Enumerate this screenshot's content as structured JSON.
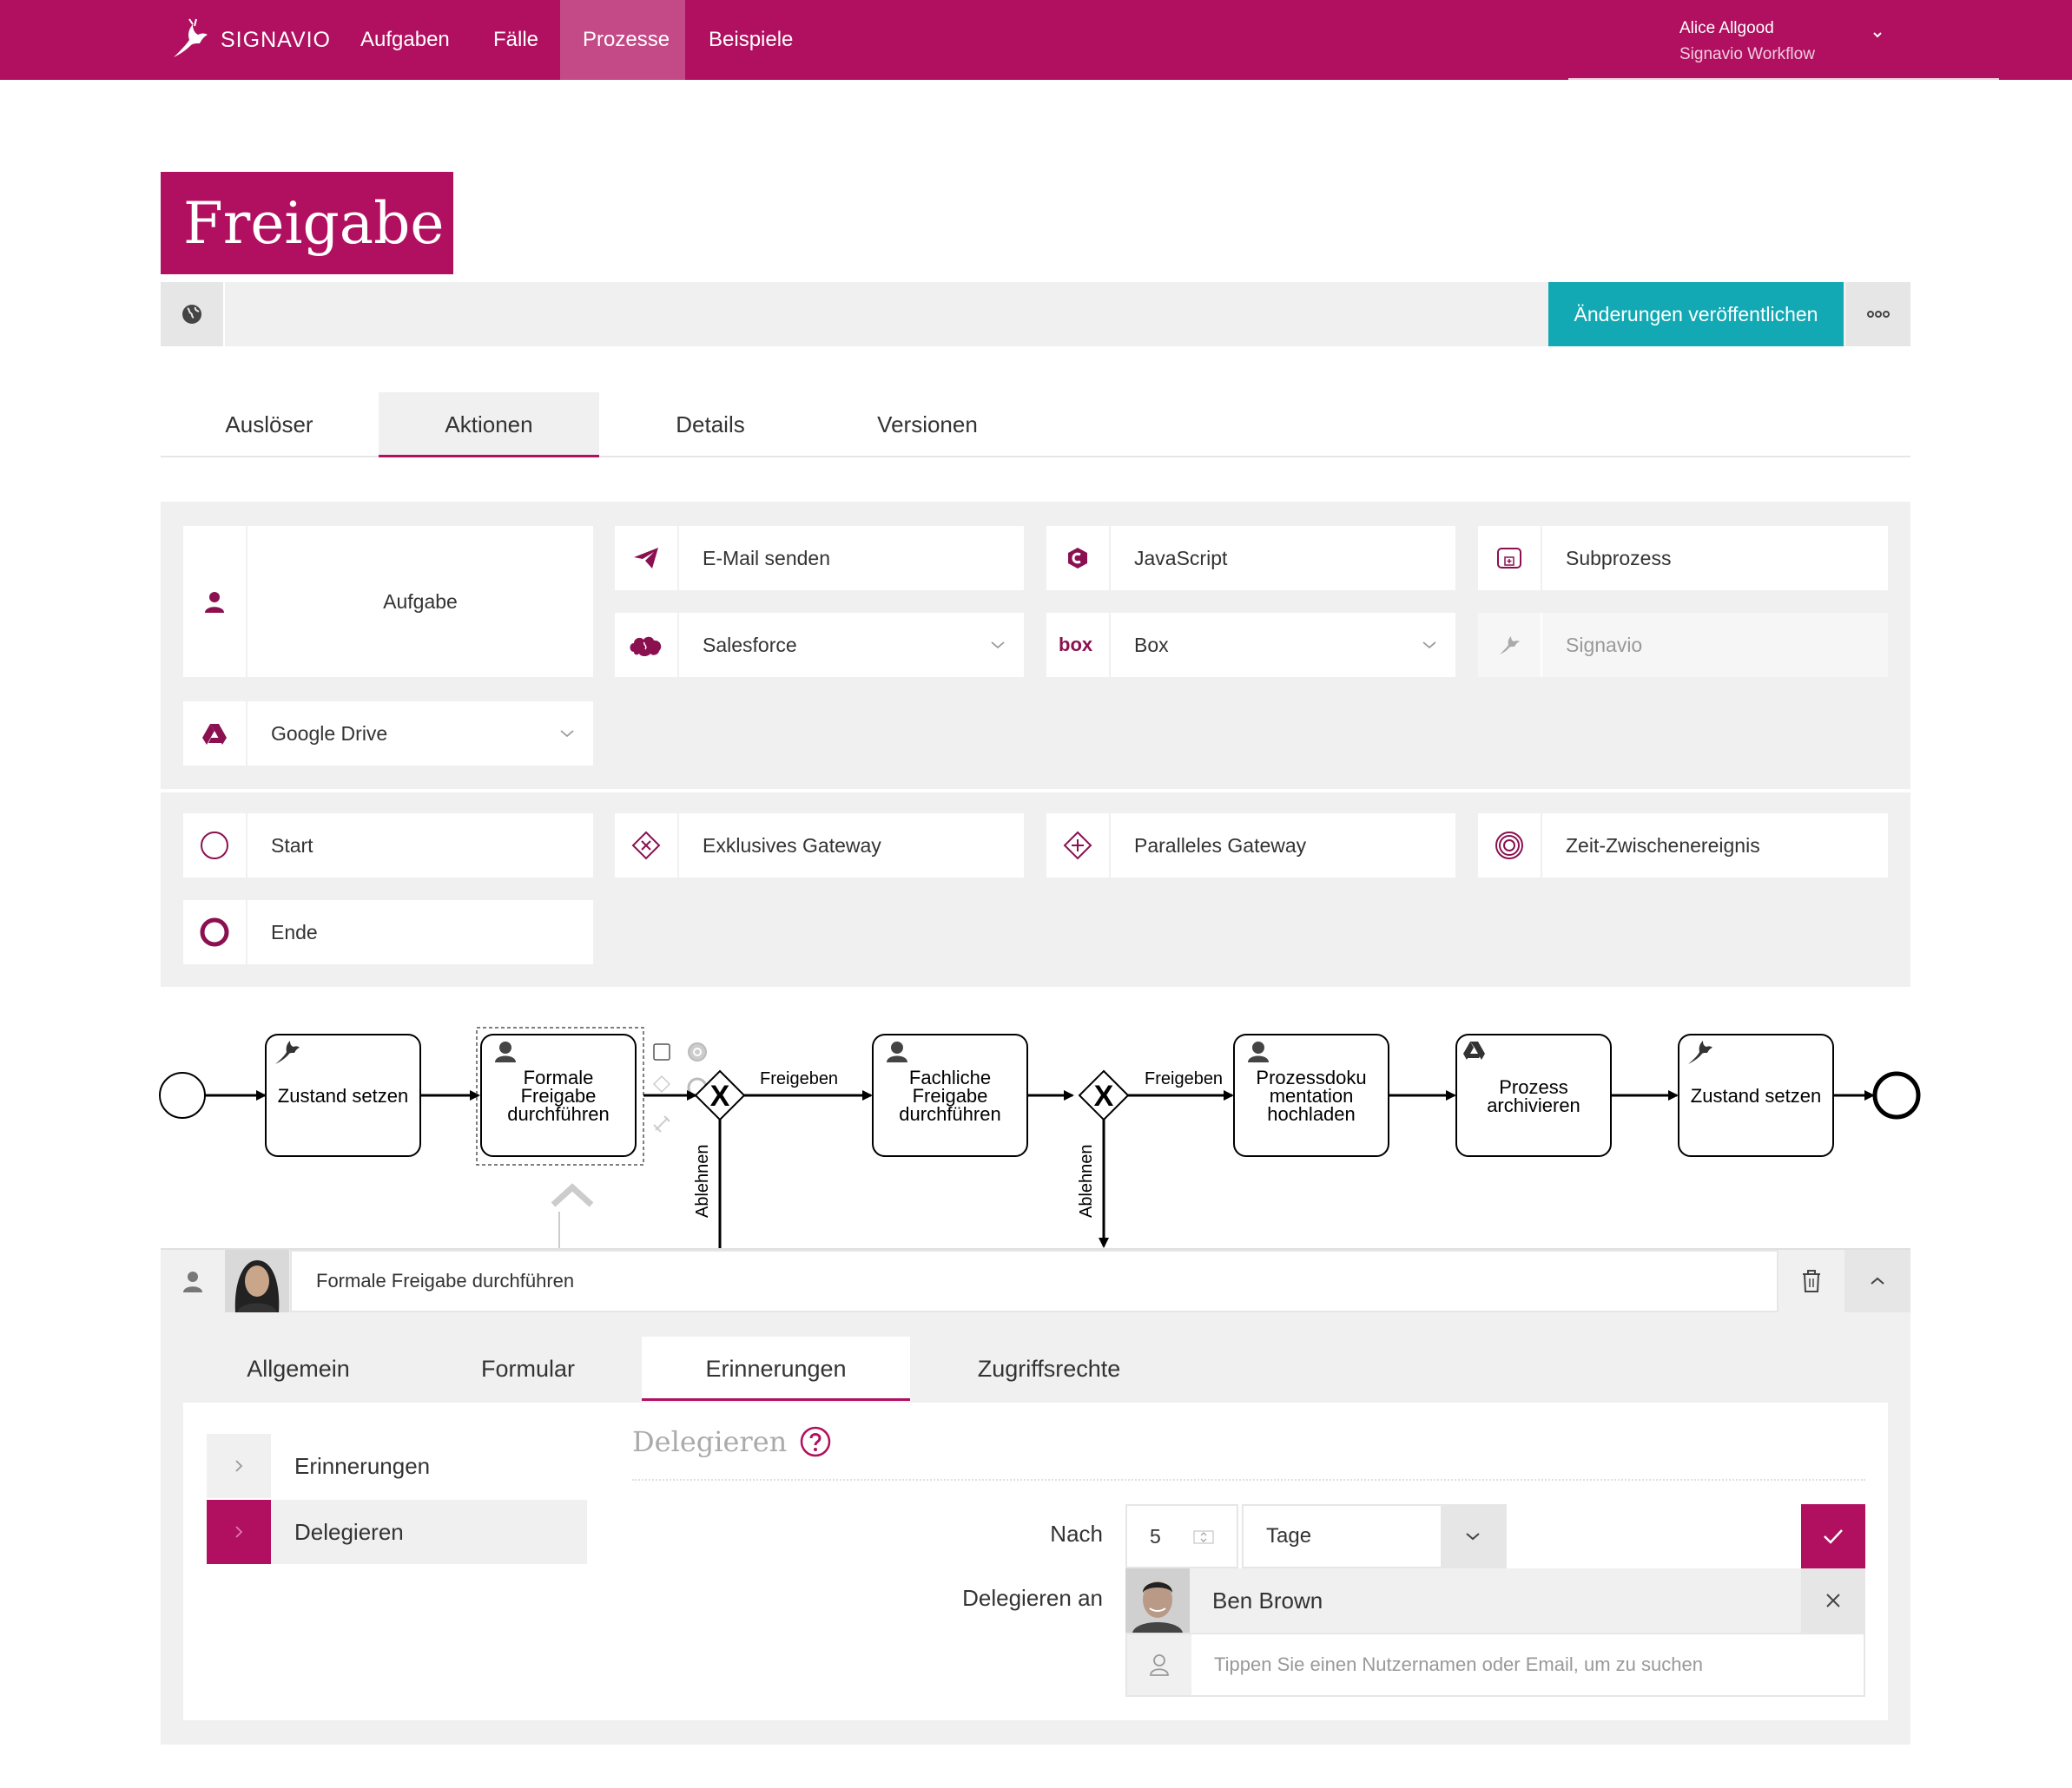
{
  "nav": {
    "brand": "SIGNAVIO",
    "items": [
      {
        "label": "Aufgaben",
        "active": false
      },
      {
        "label": "Fälle",
        "active": false
      },
      {
        "label": "Prozesse",
        "active": true
      },
      {
        "label": "Beispiele",
        "active": false
      }
    ],
    "user_name": "Alice Allgood",
    "user_org": "Signavio Workflow"
  },
  "page": {
    "title": "Freigabe",
    "publish_label": "Änderungen veröffentlichen"
  },
  "tabs": [
    {
      "label": "Auslöser",
      "active": false
    },
    {
      "label": "Aktionen",
      "active": true
    },
    {
      "label": "Details",
      "active": false
    },
    {
      "label": "Versionen",
      "active": false
    }
  ],
  "palette": {
    "actions": [
      {
        "label": "Aufgabe",
        "icon": "user-icon"
      },
      {
        "label": "E-Mail senden",
        "icon": "paper-plane-icon"
      },
      {
        "label": "JavaScript",
        "icon": "javascript-icon"
      },
      {
        "label": "Subprozess",
        "icon": "subprocess-icon"
      },
      {
        "label": "Salesforce",
        "icon": "salesforce-icon"
      },
      {
        "label": "Box",
        "icon": "box-icon"
      },
      {
        "label": "Signavio",
        "icon": "signavio-icon",
        "disabled": true
      },
      {
        "label": "Google Drive",
        "icon": "google-drive-icon"
      }
    ],
    "events": [
      {
        "label": "Start",
        "icon": "start-event-icon"
      },
      {
        "label": "Exklusives Gateway",
        "icon": "exclusive-gateway-icon"
      },
      {
        "label": "Paralleles Gateway",
        "icon": "parallel-gateway-icon"
      },
      {
        "label": "Zeit-Zwischenereignis",
        "icon": "timer-event-icon"
      },
      {
        "label": "Ende",
        "icon": "end-event-icon"
      }
    ]
  },
  "diagram": {
    "tasks": [
      {
        "lines": [
          "Zustand setzen"
        ],
        "icon": "signavio-icon"
      },
      {
        "lines": [
          "Formale",
          "Freigabe",
          "durchführen"
        ],
        "icon": "user-icon"
      },
      {
        "lines": [
          "Fachliche",
          "Freigabe",
          "durchführen"
        ],
        "icon": "user-icon"
      },
      {
        "lines": [
          "Prozessdoku",
          "mentation",
          "hochladen"
        ],
        "icon": "user-icon"
      },
      {
        "lines": [
          "Prozess",
          "archivieren"
        ],
        "icon": "google-drive-icon"
      },
      {
        "lines": [
          "Zustand setzen"
        ],
        "icon": "signavio-icon"
      }
    ],
    "approve_label": "Freigeben",
    "reject_label": "Ablehnen",
    "gateway_mark": "X"
  },
  "detail": {
    "title": "Formale Freigabe durchführen",
    "tabs": [
      {
        "label": "Allgemein",
        "active": false
      },
      {
        "label": "Formular",
        "active": false
      },
      {
        "label": "Erinnerungen",
        "active": true
      },
      {
        "label": "Zugriffsrechte",
        "active": false
      }
    ],
    "side": [
      {
        "label": "Erinnerungen",
        "active": false
      },
      {
        "label": "Delegieren",
        "active": true
      }
    ],
    "section_title": "Delegieren",
    "after_label": "Nach",
    "after_value": "5",
    "unit_value": "Tage",
    "delegate_label": "Delegieren an",
    "delegate_user": "Ben Brown",
    "search_placeholder": "Tippen Sie einen Nutzernamen oder Email, um zu suchen"
  },
  "colors": {
    "brand": "#b0105f",
    "teal": "#12a9b4",
    "panel": "#f0f0f0"
  }
}
